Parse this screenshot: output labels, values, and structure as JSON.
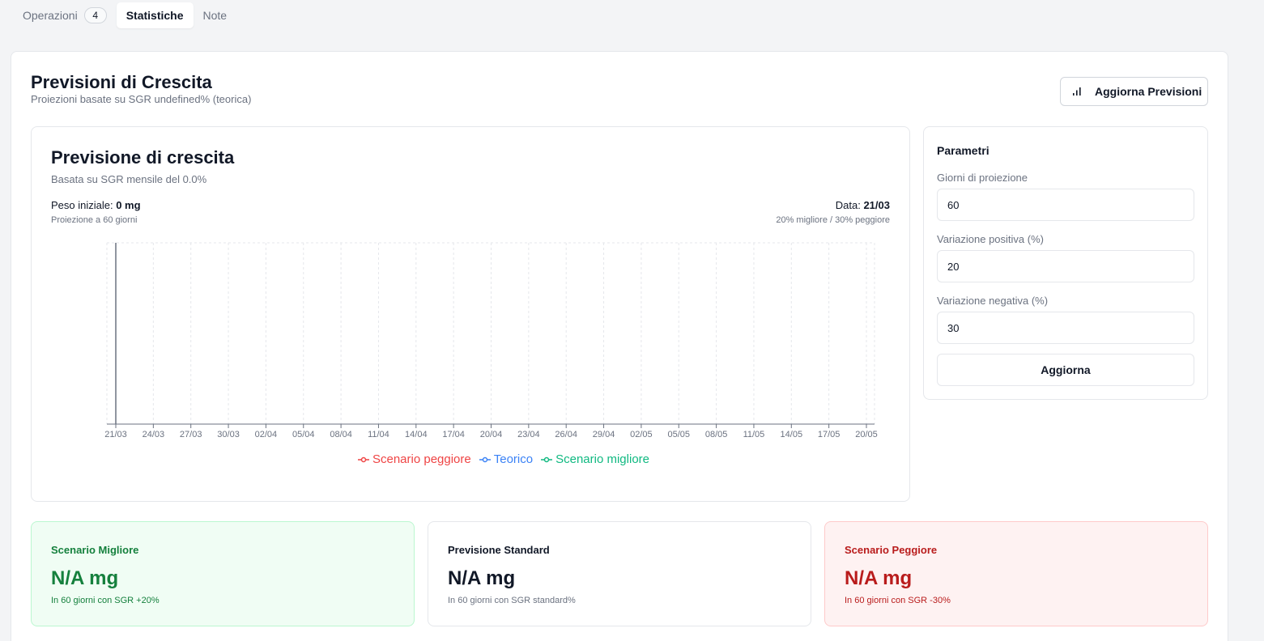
{
  "tabs": [
    {
      "label": "Operazioni",
      "count": "4"
    },
    {
      "label": "Statistiche"
    },
    {
      "label": "Note"
    }
  ],
  "page": {
    "title": "Previsioni di Crescita",
    "subtitle": "Proiezioni basate su SGR undefined% (teorica)",
    "refresh_button": "Aggiorna Previsioni",
    "refresh_icon": "bar-chart-icon"
  },
  "chart_card": {
    "title": "Previsione di crescita",
    "subtitle": "Basata su SGR mensile del 0.0%",
    "peso_label": "Peso iniziale: ",
    "peso_value": "0 mg",
    "projection_note": "Proiezione a 60 giorni",
    "data_label": "Data: ",
    "data_value": "21/03",
    "variation_note": "20% migliore / 30% peggiore"
  },
  "chart_data": {
    "type": "line",
    "x": [
      "21/03",
      "24/03",
      "27/03",
      "30/03",
      "02/04",
      "05/04",
      "08/04",
      "11/04",
      "14/04",
      "17/04",
      "20/04",
      "23/04",
      "26/04",
      "29/04",
      "02/05",
      "05/05",
      "08/05",
      "11/05",
      "14/05",
      "17/05",
      "20/05"
    ],
    "series": [
      {
        "name": "Scenario peggiore",
        "color": "#ef4444",
        "values": []
      },
      {
        "name": "Teorico",
        "color": "#3b82f6",
        "values": []
      },
      {
        "name": "Scenario migliore",
        "color": "#10b981",
        "values": []
      }
    ],
    "grid": true,
    "legend": "bottom"
  },
  "params": {
    "title": "Parametri",
    "days_label": "Giorni di proiezione",
    "days_value": "60",
    "pos_label": "Variazione positiva (%)",
    "pos_value": "20",
    "neg_label": "Variazione negativa (%)",
    "neg_value": "30",
    "apply_button": "Aggiorna"
  },
  "scenarios": {
    "best": {
      "title": "Scenario Migliore",
      "value": "N/A mg",
      "desc": "In 60 giorni con SGR +20%"
    },
    "standard": {
      "title": "Previsione Standard",
      "value": "N/A mg",
      "desc": "In 60 giorni con SGR standard%"
    },
    "worst": {
      "title": "Scenario Peggiore",
      "value": "N/A mg",
      "desc": "In 60 giorni con SGR -30%"
    }
  },
  "colors": {
    "worst": "#ef4444",
    "standard": "#3b82f6",
    "best": "#10b981"
  }
}
